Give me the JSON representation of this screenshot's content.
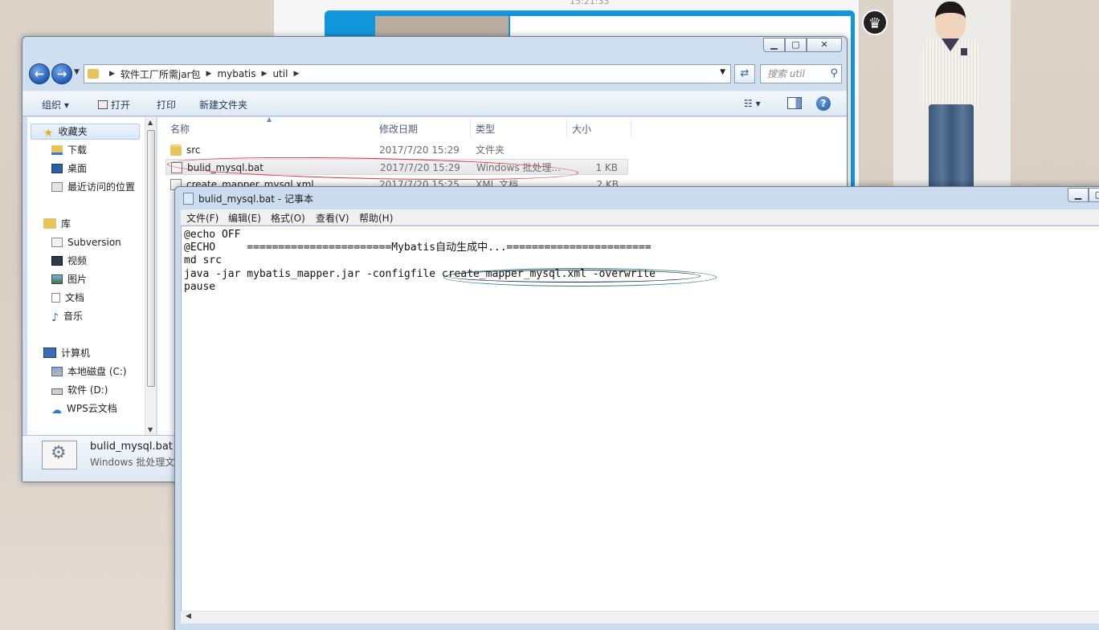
{
  "background": {
    "chat_time": "15:21:33"
  },
  "explorer": {
    "address": {
      "crumbs": [
        "软件工厂所需jar包",
        "mybatis",
        "util"
      ],
      "search_placeholder": "搜索 util"
    },
    "toolbar": {
      "organize": "组织 ▾",
      "open": "打开",
      "print": "打印",
      "new_folder": "新建文件夹"
    },
    "nav": {
      "favorites": "收藏夹",
      "fav_items": [
        "下载",
        "桌面",
        "最近访问的位置"
      ],
      "library": "库",
      "lib_items": [
        "Subversion",
        "视频",
        "图片",
        "文档",
        "音乐"
      ],
      "computer": "计算机",
      "comp_items": [
        "本地磁盘 (C:)",
        "软件 (D:)",
        "WPS云文档"
      ]
    },
    "columns": {
      "name": "名称",
      "date": "修改日期",
      "type": "类型",
      "size": "大小"
    },
    "files": [
      {
        "name": "src",
        "date": "2017/7/20 15:29",
        "type": "文件夹",
        "size": ""
      },
      {
        "name": "bulid_mysql.bat",
        "date": "2017/7/20 15:29",
        "type": "Windows 批处理...",
        "size": "1 KB"
      },
      {
        "name": "create_mapper_mysql.xml",
        "date": "2017/7/20 15:25",
        "type": "XML 文档",
        "size": "2 KB"
      }
    ],
    "details": {
      "name": "bulid_mysql.bat",
      "type": "Windows 批处理文件"
    }
  },
  "notepad": {
    "title": "bulid_mysql.bat - 记事本",
    "menu": [
      "文件(F)",
      "编辑(E)",
      "格式(O)",
      "查看(V)",
      "帮助(H)"
    ],
    "lines": [
      "@echo OFF",
      "@ECHO     =======================Mybatis自动生成中...=======================",
      "md src",
      "java -jar mybatis_mapper.jar -configfile create_mapper_mysql.xml -overwrite",
      "pause"
    ]
  },
  "colors": {
    "selection_red": "#d9363e",
    "annotation_teal": "#2a7f76",
    "chat_blue": "#1296db"
  }
}
